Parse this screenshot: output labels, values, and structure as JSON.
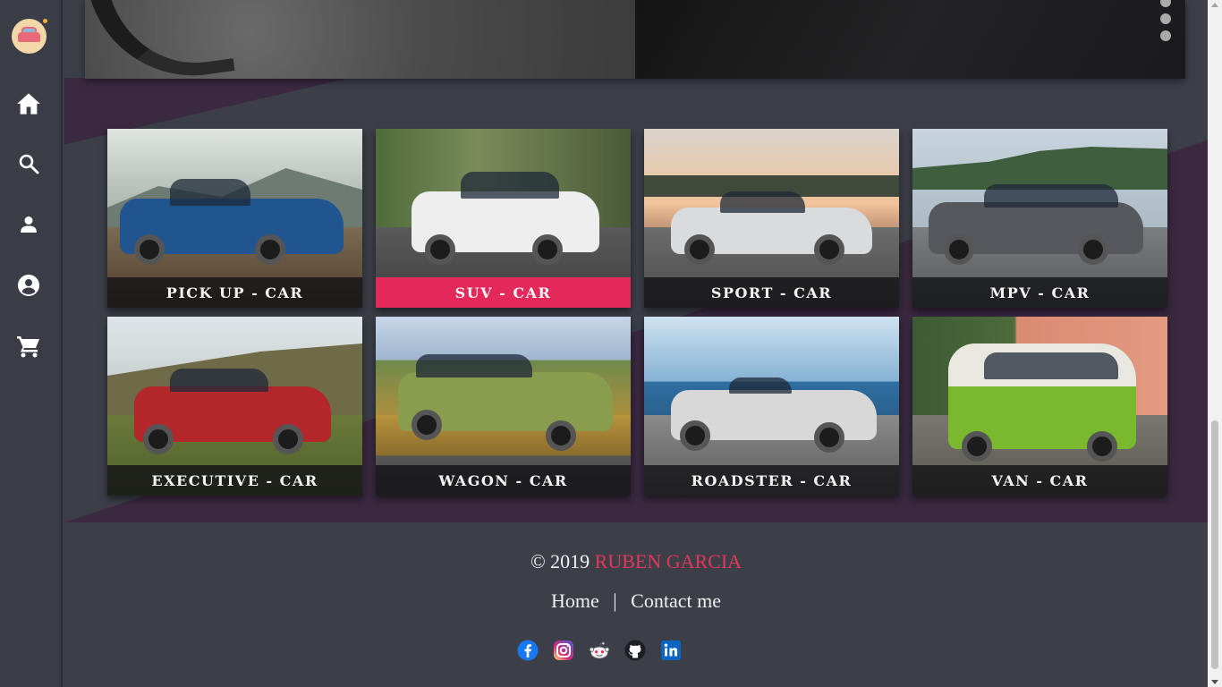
{
  "sidebar": {
    "logo_icon": "car-logo-icon",
    "items": [
      {
        "name": "home",
        "icon": "home-icon"
      },
      {
        "name": "search",
        "icon": "search-icon"
      },
      {
        "name": "user",
        "icon": "user-icon"
      },
      {
        "name": "account",
        "icon": "account-circle-icon"
      },
      {
        "name": "cart",
        "icon": "cart-icon"
      }
    ]
  },
  "cards": [
    {
      "label": "PICK UP - CAR",
      "active": false
    },
    {
      "label": "SUV - CAR",
      "active": true
    },
    {
      "label": "SPORT - CAR",
      "active": false
    },
    {
      "label": "MPV - CAR",
      "active": false
    },
    {
      "label": "EXECUTIVE - CAR",
      "active": false
    },
    {
      "label": "WAGON - CAR",
      "active": false
    },
    {
      "label": "ROADSTER - CAR",
      "active": false
    },
    {
      "label": "VAN - CAR",
      "active": false
    }
  ],
  "footer": {
    "copyright_prefix": "© 2019",
    "author": "RUBEN GARCIA",
    "links": {
      "home": "Home",
      "separator": "|",
      "contact": "Contact me"
    },
    "social": [
      "facebook-icon",
      "instagram-icon",
      "reddit-icon",
      "github-icon",
      "linkedin-icon"
    ]
  },
  "colors": {
    "accent": "#e4285a",
    "background": "#3c3f48",
    "band": "#3a2940"
  }
}
